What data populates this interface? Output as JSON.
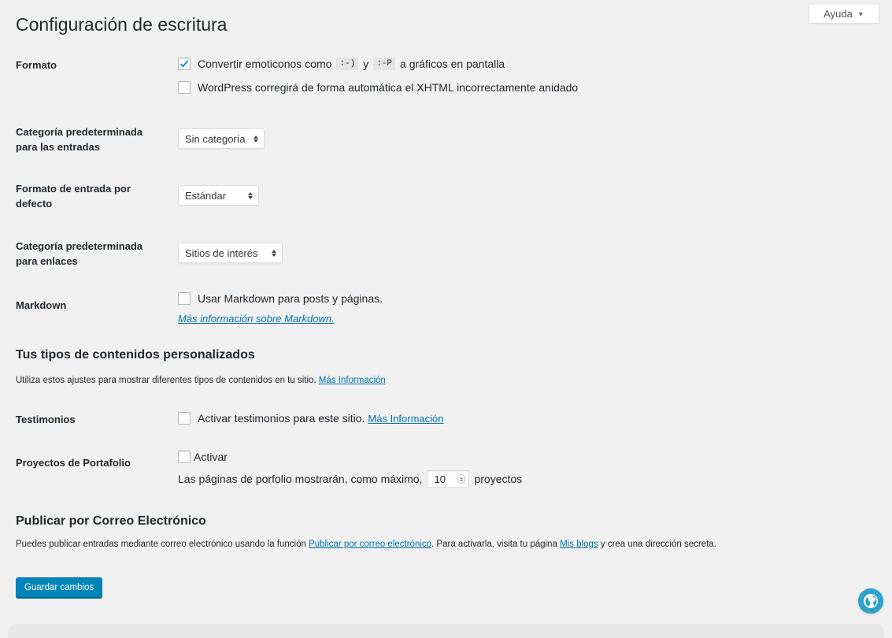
{
  "help_tab": {
    "label": "Ayuda",
    "arrow": "▼"
  },
  "page_title": "Configuración de escritura",
  "formato": {
    "label": "Formato",
    "emoticons": {
      "checked": true,
      "text_before": "Convertir emoticonos como",
      "code1": ":-)",
      "and": "y",
      "code2": ":-P",
      "text_after": "a gráficos en pantalla"
    },
    "xhtml": {
      "checked": false,
      "text": "WordPress corregirá de forma automática el XHTML incorrectamente anidado"
    }
  },
  "default_post_category": {
    "label": "Categoría predeterminada para las entradas",
    "selected": "Sin categoría"
  },
  "default_post_format": {
    "label": "Formato de entrada por defecto",
    "selected": "Estándar"
  },
  "default_link_category": {
    "label": "Categoría predeterminada para enlaces",
    "selected": "Sitios de interés"
  },
  "markdown": {
    "label": "Markdown",
    "checked": false,
    "text": "Usar Markdown para posts y páginas.",
    "link": "Más información sobre Markdown."
  },
  "custom_content": {
    "heading": "Tus tipos de contenidos personalizados",
    "desc": "Utiliza estos ajustes para mostrar diferentes tipos de contenidos en tu sitio.",
    "desc_link": "Más Información"
  },
  "testimonios": {
    "label": "Testimonios",
    "checked": false,
    "text": "Activar testimonios para este sitio.",
    "link": "Más Información"
  },
  "portfolio": {
    "label": "Proyectos de Portafolio",
    "checked": false,
    "activate_text": "Activar",
    "per_page_before": "Las páginas de porfolio mostrarán, como máximo,",
    "per_page_value": "10",
    "per_page_after": "proyectos"
  },
  "email_publish": {
    "heading": "Publicar por Correo Electrónico",
    "desc_1": "Puedes publicar entradas mediante correo electrónico usando la función",
    "link_1": "Publicar por correo electrónico",
    "desc_2": ". Para activarla, visita tu página",
    "link_2": "Mis blogs",
    "desc_3": "y crea una dirección secreta."
  },
  "save_button": "Guardar cambios",
  "colors": {
    "link": "#0073aa",
    "primary": "#0085ba",
    "globe": "#2ea2cc"
  }
}
